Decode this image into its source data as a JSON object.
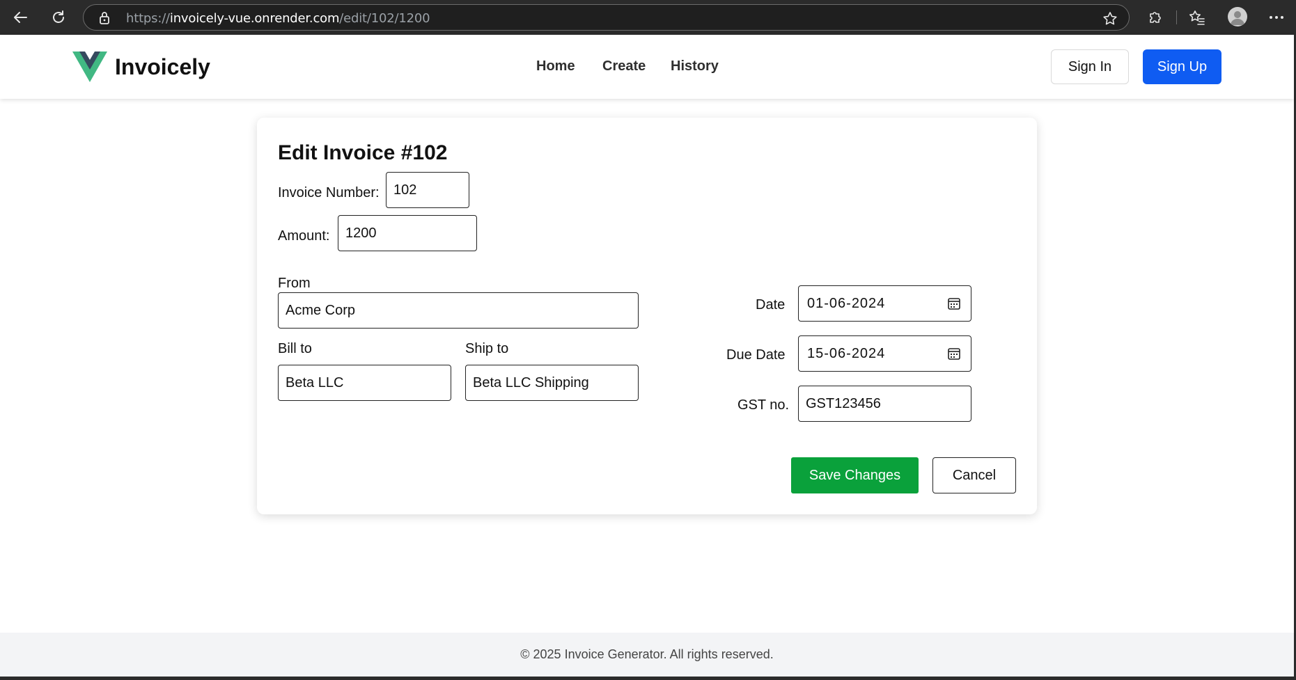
{
  "browser": {
    "url_prefix": "https://",
    "url_host": "invoicely-vue.onrender.com",
    "url_path": "/edit/102/1200"
  },
  "header": {
    "brand": "Invoicely",
    "nav": [
      {
        "label": "Home"
      },
      {
        "label": "Create"
      },
      {
        "label": "History"
      }
    ],
    "signin_label": "Sign In",
    "signup_label": "Sign Up"
  },
  "form": {
    "title": "Edit Invoice #102",
    "invoice_number_label": "Invoice Number:",
    "invoice_number_value": "102",
    "amount_label": "Amount:",
    "amount_value": "1200",
    "from_label": "From",
    "from_value": "Acme Corp",
    "bill_to_label": "Bill to",
    "bill_to_value": "Beta LLC",
    "ship_to_label": "Ship to",
    "ship_to_value": "Beta LLC Shipping",
    "date_label": "Date",
    "date_value": "01-06-2024",
    "due_date_label": "Due Date",
    "due_date_value": "15-06-2024",
    "gst_label": "GST no.",
    "gst_value": "GST123456",
    "save_label": "Save Changes",
    "cancel_label": "Cancel"
  },
  "footer": {
    "text": "© 2025 Invoice Generator. All rights reserved."
  },
  "colors": {
    "primary": "#0f5cf2",
    "success": "#0aa13b",
    "logo_dark": "#35495e",
    "logo_light": "#41b883"
  }
}
